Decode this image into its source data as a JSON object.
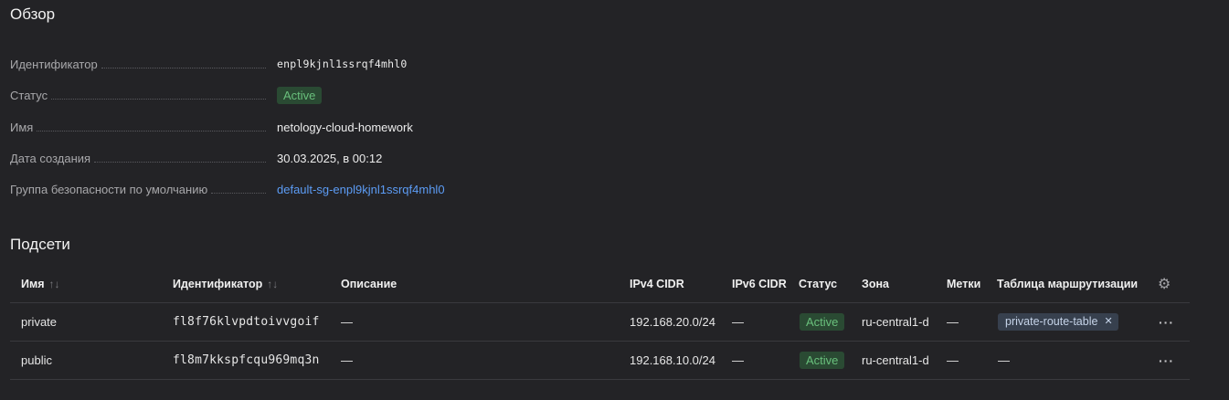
{
  "overview": {
    "title": "Обзор",
    "fields": [
      {
        "label": "Идентификатор",
        "value": "enpl9kjnl1ssrqf4mhl0"
      },
      {
        "label": "Статус",
        "value": "Active"
      },
      {
        "label": "Имя",
        "value": "netology-cloud-homework"
      },
      {
        "label": "Дата создания",
        "value": "30.03.2025, в 00:12"
      },
      {
        "label": "Группа безопасности по умолчанию",
        "value": "default-sg-enpl9kjnl1ssrqf4mhl0"
      }
    ]
  },
  "subnets": {
    "title": "Подсети",
    "columns": {
      "name": "Имя",
      "id": "Идентификатор",
      "description": "Описание",
      "ipv4": "IPv4 CIDR",
      "ipv6": "IPv6 CIDR",
      "status": "Статус",
      "zone": "Зона",
      "labels": "Метки",
      "route_table": "Таблица маршрутизации"
    },
    "sort_icon": "↑↓",
    "rows": [
      {
        "name": "private",
        "id": "fl8f76klvpdtoivvgoif",
        "description": "—",
        "ipv4": "192.168.20.0/24",
        "ipv6": "—",
        "status": "Active",
        "zone": "ru-central1-d",
        "labels": "—",
        "route_table": "private-route-table"
      },
      {
        "name": "public",
        "id": "fl8m7kkspfcqu969mq3n",
        "description": "—",
        "ipv4": "192.168.10.0/24",
        "ipv6": "—",
        "status": "Active",
        "zone": "ru-central1-d",
        "labels": "—",
        "route_table": "—"
      }
    ]
  },
  "icons": {
    "settings": "gear-icon",
    "more": "more-actions-icon",
    "close": "close-icon",
    "sort": "sort-icon"
  },
  "colors": {
    "status_active_bg": "#2a4a33",
    "status_active_text": "#69c07c",
    "link": "#5c9cf5"
  }
}
